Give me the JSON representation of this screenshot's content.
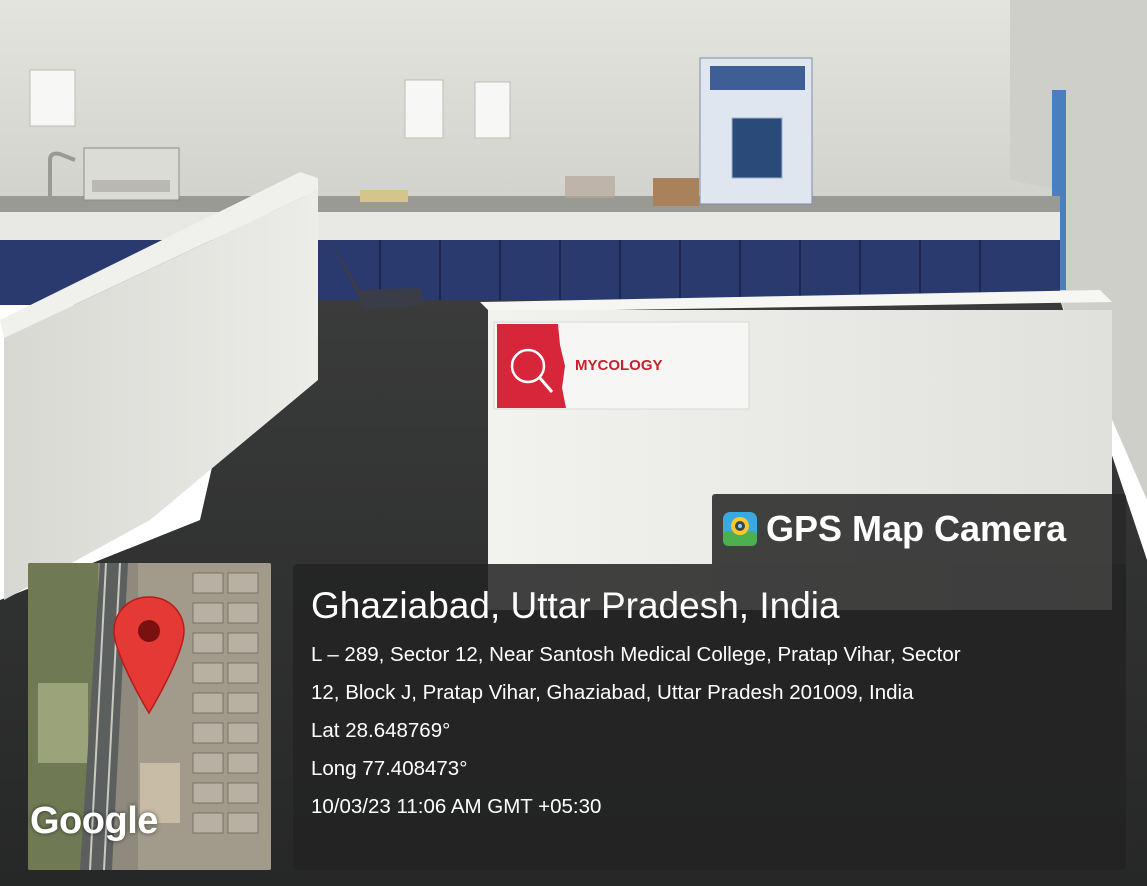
{
  "scene": {
    "description_colors": {
      "wall": "#d9d9d4",
      "floor": "#2f3030",
      "cabinets": "#2a3a6e",
      "partition": "#eeeeea",
      "sign_red": "#d7263a"
    },
    "sign": {
      "label": "MYCOLOGY"
    }
  },
  "map_thumbnail": {
    "provider_label": "Google",
    "pin_icon": "map-pin-icon"
  },
  "app_badge": {
    "icon": "gps-camera-icon",
    "name": "GPS Map Camera"
  },
  "location": {
    "place": "Ghaziabad, Uttar Pradesh, India",
    "address_line_1": "L – 289, Sector 12, Near Santosh Medical College, Pratap Vihar, Sector",
    "address_line_2": "12, Block J, Pratap Vihar, Ghaziabad, Uttar Pradesh 201009, India",
    "latitude": "Lat 28.648769°",
    "longitude": "Long 77.408473°",
    "timestamp": "10/03/23 11:06 AM GMT +05:30"
  }
}
